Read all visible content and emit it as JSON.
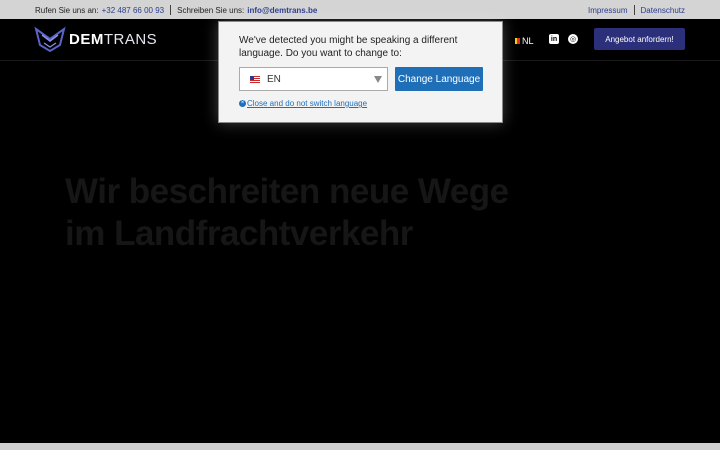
{
  "topbar": {
    "call_label": "Rufen Sie uns an:",
    "phone": "+32 487 66 00 93",
    "write_label": "Schreiben Sie uns:",
    "email": "info@demtrans.be",
    "impressum": "Impressum",
    "datenschutz": "Datenschutz"
  },
  "header": {
    "logo_bold": "DEM",
    "logo_light": "TRANS",
    "language": "NL",
    "cta": "Angebot anfordern!"
  },
  "hero": {
    "title_line1": "Wir beschreiten neue Wege",
    "title_line2": "im Landfrachtverkehr"
  },
  "modal": {
    "message": "We've detected you might be speaking a different language. Do you want to change to:",
    "selected_language": "EN",
    "change_button": "Change Language",
    "close_link": "Close and do not switch language"
  },
  "icons": [
    "demtrans-logo-icon",
    "belgium-flag-icon",
    "linkedin-icon",
    "whatsapp-icon",
    "us-flag-icon",
    "dropdown-caret-icon",
    "close-circle-icon"
  ],
  "colors": {
    "brand": "#2c2f7a",
    "link": "#2a3d8f",
    "modal_button": "#1f6fb8",
    "topbar_bg": "#d4d4d4"
  }
}
